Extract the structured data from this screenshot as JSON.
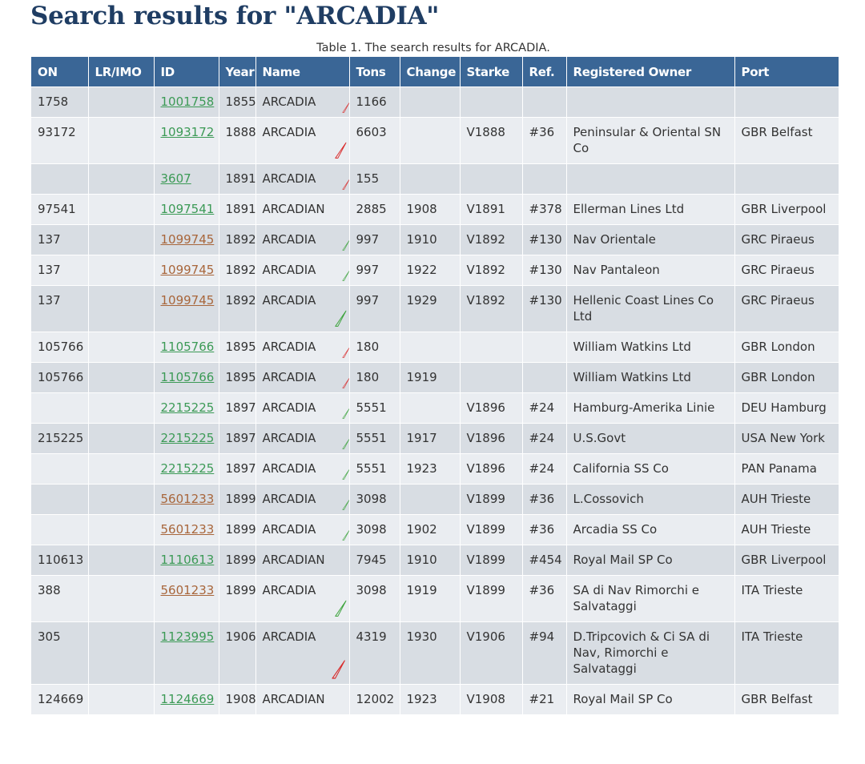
{
  "page": {
    "title": "Search results for \"ARCADIA\"",
    "caption": "Table 1. The search results for ARCADIA."
  },
  "colors": {
    "header_bg": "#3a6696",
    "row_odd": "#d8dde3",
    "row_even": "#eaedf1",
    "link_green": "#3c9a56",
    "link_brown": "#a8663b",
    "marker_red": "#d92b2b",
    "marker_green": "#3aa33a"
  },
  "table": {
    "columns": [
      "ON",
      "LR/IMO",
      "ID",
      "Year",
      "Name",
      "Tons",
      "Change",
      "Starke",
      "Ref.",
      "Registered Owner",
      "Port"
    ],
    "rows": [
      {
        "on": "1758",
        "lrimo": "",
        "id": "1001758",
        "link_color": "green",
        "year": "1855",
        "name": "ARCADIA",
        "marker": "red",
        "tons": "1166",
        "change": "",
        "starke": "",
        "ref": "",
        "owner": "",
        "port": ""
      },
      {
        "on": "93172",
        "lrimo": "",
        "id": "1093172",
        "link_color": "green",
        "year": "1888",
        "name": "ARCADIA",
        "marker": "red",
        "tons": "6603",
        "change": "",
        "starke": "V1888",
        "ref": "#36",
        "owner": "Peninsular & Oriental SN Co",
        "port": "GBR Belfast"
      },
      {
        "on": "",
        "lrimo": "",
        "id": "3607",
        "link_color": "green",
        "year": "1891",
        "name": "ARCADIA",
        "marker": "red",
        "tons": "155",
        "change": "",
        "starke": "",
        "ref": "",
        "owner": "",
        "port": ""
      },
      {
        "on": "97541",
        "lrimo": "",
        "id": "1097541",
        "link_color": "green",
        "year": "1891",
        "name": "ARCADIAN",
        "marker": "",
        "tons": "2885",
        "change": "1908",
        "starke": "V1891",
        "ref": "#378",
        "owner": "Ellerman Lines Ltd",
        "port": "GBR Liverpool"
      },
      {
        "on": "137",
        "lrimo": "",
        "id": "1099745",
        "link_color": "brown",
        "year": "1892",
        "name": "ARCADIA",
        "marker": "green",
        "tons": "997",
        "change": "1910",
        "starke": "V1892",
        "ref": "#130",
        "owner": "Nav Orientale",
        "port": "GRC Piraeus"
      },
      {
        "on": "137",
        "lrimo": "",
        "id": "1099745",
        "link_color": "brown",
        "year": "1892",
        "name": "ARCADIA",
        "marker": "green",
        "tons": "997",
        "change": "1922",
        "starke": "V1892",
        "ref": "#130",
        "owner": "Nav Pantaleon",
        "port": "GRC Piraeus"
      },
      {
        "on": "137",
        "lrimo": "",
        "id": "1099745",
        "link_color": "brown",
        "year": "1892",
        "name": "ARCADIA",
        "marker": "green",
        "tons": "997",
        "change": "1929",
        "starke": "V1892",
        "ref": "#130",
        "owner": "Hellenic Coast Lines Co Ltd",
        "port": "GRC Piraeus"
      },
      {
        "on": "105766",
        "lrimo": "",
        "id": "1105766",
        "link_color": "green",
        "year": "1895",
        "name": "ARCADIA",
        "marker": "red",
        "tons": "180",
        "change": "",
        "starke": "",
        "ref": "",
        "owner": "William Watkins Ltd",
        "port": "GBR London"
      },
      {
        "on": "105766",
        "lrimo": "",
        "id": "1105766",
        "link_color": "green",
        "year": "1895",
        "name": "ARCADIA",
        "marker": "red",
        "tons": "180",
        "change": "1919",
        "starke": "",
        "ref": "",
        "owner": "William Watkins Ltd",
        "port": "GBR London"
      },
      {
        "on": "",
        "lrimo": "",
        "id": "2215225",
        "link_color": "green",
        "year": "1897",
        "name": "ARCADIA",
        "marker": "green",
        "tons": "5551",
        "change": "",
        "starke": "V1896",
        "ref": "#24",
        "owner": "Hamburg-Amerika Linie",
        "port": "DEU Hamburg"
      },
      {
        "on": "215225",
        "lrimo": "",
        "id": "2215225",
        "link_color": "green",
        "year": "1897",
        "name": "ARCADIA",
        "marker": "green",
        "tons": "5551",
        "change": "1917",
        "starke": "V1896",
        "ref": "#24",
        "owner": "U.S.Govt",
        "port": "USA New York"
      },
      {
        "on": "",
        "lrimo": "",
        "id": "2215225",
        "link_color": "green",
        "year": "1897",
        "name": "ARCADIA",
        "marker": "green",
        "tons": "5551",
        "change": "1923",
        "starke": "V1896",
        "ref": "#24",
        "owner": "California SS Co",
        "port": "PAN Panama"
      },
      {
        "on": "",
        "lrimo": "",
        "id": "5601233",
        "link_color": "brown",
        "year": "1899",
        "name": "ARCADIA",
        "marker": "green",
        "tons": "3098",
        "change": "",
        "starke": "V1899",
        "ref": "#36",
        "owner": "L.Cossovich",
        "port": "AUH Trieste"
      },
      {
        "on": "",
        "lrimo": "",
        "id": "5601233",
        "link_color": "brown",
        "year": "1899",
        "name": "ARCADIA",
        "marker": "green",
        "tons": "3098",
        "change": "1902",
        "starke": "V1899",
        "ref": "#36",
        "owner": "Arcadia SS Co",
        "port": "AUH Trieste"
      },
      {
        "on": "110613",
        "lrimo": "",
        "id": "1110613",
        "link_color": "green",
        "year": "1899",
        "name": "ARCADIAN",
        "marker": "",
        "tons": "7945",
        "change": "1910",
        "starke": "V1899",
        "ref": "#454",
        "owner": "Royal Mail SP Co",
        "port": "GBR Liverpool"
      },
      {
        "on": "388",
        "lrimo": "",
        "id": "5601233",
        "link_color": "brown",
        "year": "1899",
        "name": "ARCADIA",
        "marker": "green",
        "tons": "3098",
        "change": "1919",
        "starke": "V1899",
        "ref": "#36",
        "owner": "SA di Nav Rimorchi e Salvataggi",
        "port": "ITA Trieste"
      },
      {
        "on": "305",
        "lrimo": "",
        "id": "1123995",
        "link_color": "green",
        "year": "1906",
        "name": "ARCADIA",
        "marker": "red",
        "tons": "4319",
        "change": "1930",
        "starke": "V1906",
        "ref": "#94",
        "owner": "D.Tripcovich & Ci SA di Nav, Rimorchi e Salvataggi",
        "port": "ITA Trieste"
      },
      {
        "on": "124669",
        "lrimo": "",
        "id": "1124669",
        "link_color": "green",
        "year": "1908",
        "name": "ARCADIAN",
        "marker": "",
        "tons": "12002",
        "change": "1923",
        "starke": "V1908",
        "ref": "#21",
        "owner": "Royal Mail SP Co",
        "port": "GBR Belfast"
      }
    ]
  }
}
